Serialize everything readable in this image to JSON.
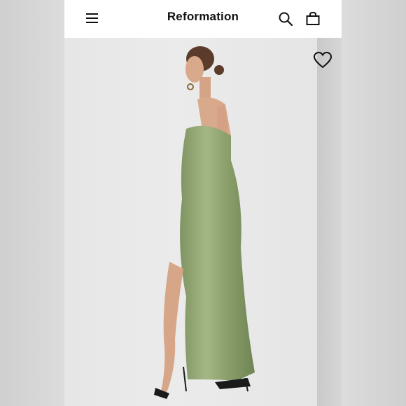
{
  "header": {
    "brand": "Reformation"
  },
  "icons": {
    "menu": "hamburger-menu-icon",
    "search": "search-icon",
    "bag": "shopping-bag-icon",
    "favorite": "heart-icon"
  },
  "colors": {
    "dress": "#8ea26f",
    "background": "#e8e8e8",
    "header_bg": "#ffffff"
  }
}
